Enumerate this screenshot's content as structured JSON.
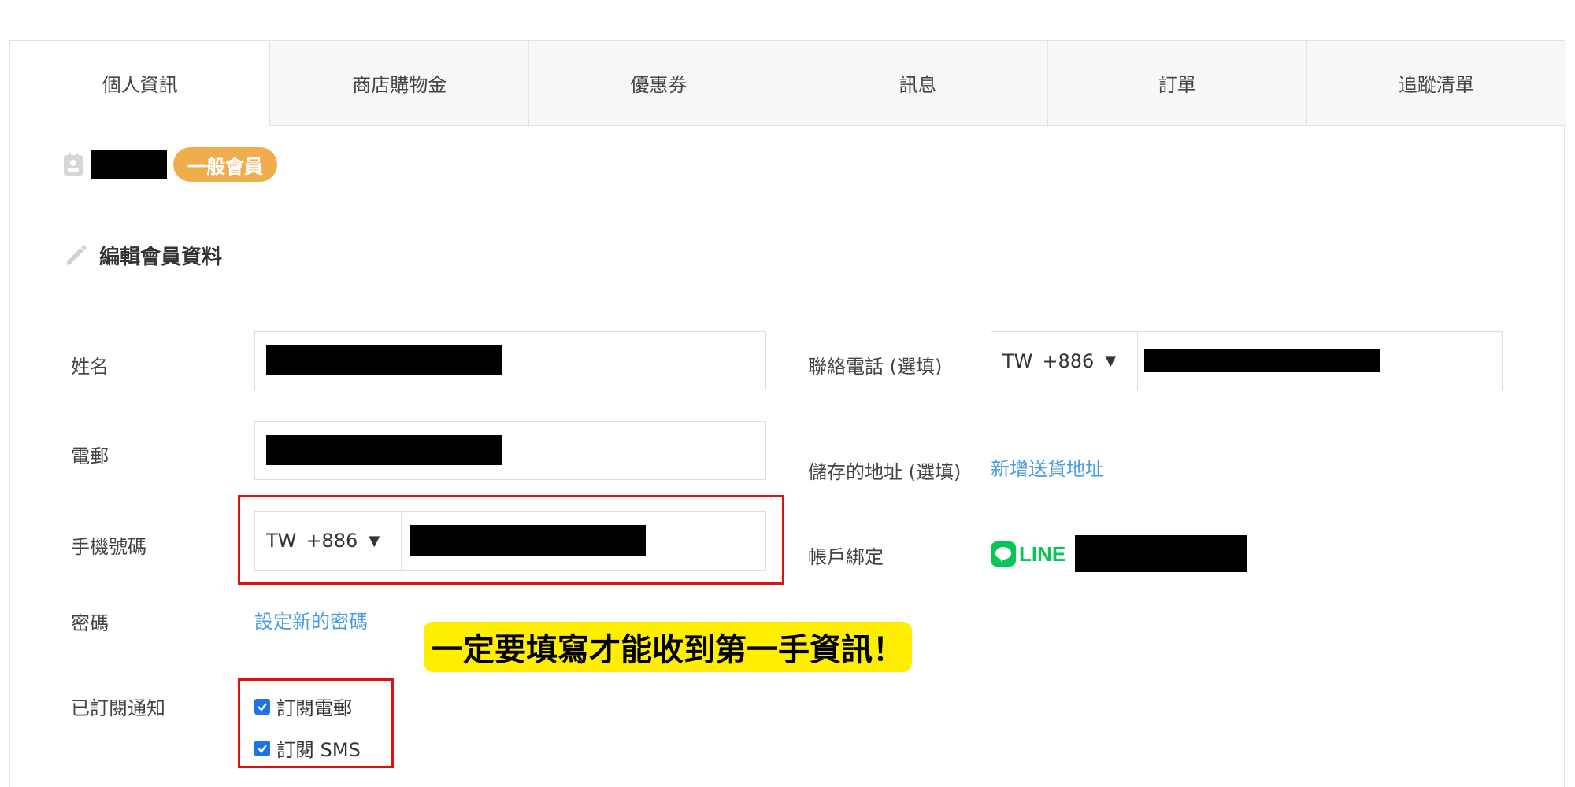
{
  "tabs": [
    {
      "label": "個人資訊",
      "active": true
    },
    {
      "label": "商店購物金",
      "active": false
    },
    {
      "label": "優惠券",
      "active": false
    },
    {
      "label": "訊息",
      "active": false
    },
    {
      "label": "訂單",
      "active": false
    },
    {
      "label": "追蹤清單",
      "active": false
    }
  ],
  "member": {
    "badge": "一般會員",
    "badge_color": "#f0ad4e"
  },
  "section": {
    "title": "編輯會員資料",
    "icon": "pencil-icon"
  },
  "form": {
    "name_label": "姓名",
    "email_label": "電郵",
    "mobile_label": "手機號碼",
    "mobile_country": "TW",
    "mobile_code": "+886",
    "password_label": "密碼",
    "password_link": "設定新的密碼",
    "subscriptions_label": "已訂閱通知",
    "subscribe_email": "訂閱電郵",
    "subscribe_sms": "訂閱 SMS",
    "contact_phone_label": "聯絡電話 (選填)",
    "contact_country": "TW",
    "contact_code": "+886",
    "saved_address_label": "儲存的地址 (選填)",
    "add_address_link": "新增送貨地址",
    "account_binding_label": "帳戶綁定",
    "line_text": "LINE"
  },
  "callout": "一定要填寫才能收到第一手資訊！",
  "colors": {
    "link": "#4a9de0",
    "highlight_border": "#e01010",
    "callout_bg": "#ffee00",
    "line_green": "#06c755",
    "checkbox": "#1a73e8"
  }
}
